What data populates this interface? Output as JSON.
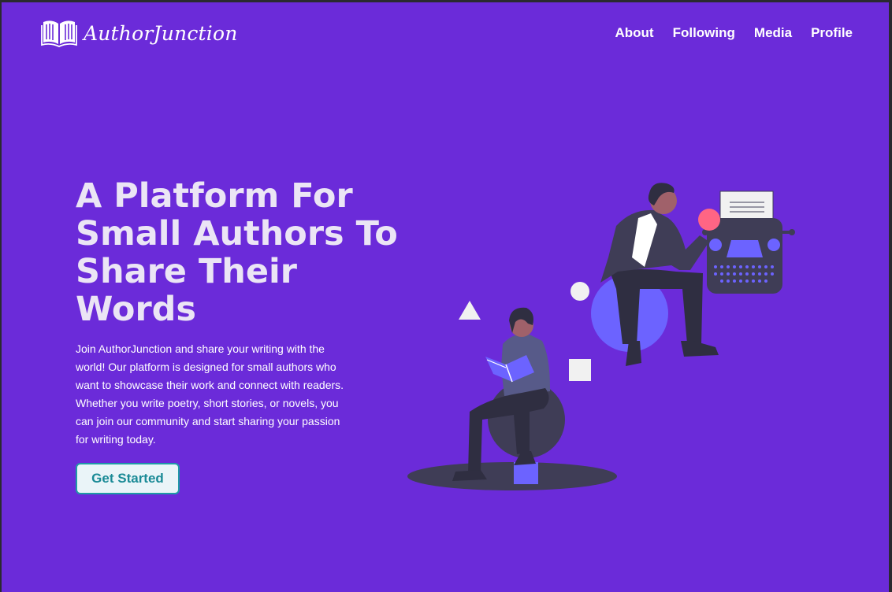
{
  "brand": {
    "name": "AuthorJunction",
    "icon": "open-book-icon"
  },
  "nav": {
    "items": [
      {
        "label": "About"
      },
      {
        "label": "Following"
      },
      {
        "label": "Media"
      },
      {
        "label": "Profile"
      }
    ]
  },
  "hero": {
    "title": "A Platform For Small Authors To Share Their Words",
    "description": "Join AuthorJunction and share your writing with the world! Our platform is designed for small authors who want to showcase their work and connect with readers. Whether you write poetry, short stories, or novels, you can join our community and start sharing your passion for writing today.",
    "cta_label": "Get Started"
  },
  "colors": {
    "background": "#6b2bd9",
    "button_bg": "#eaf4f8",
    "button_border": "#1f9aa6",
    "button_text": "#1a8a96",
    "illustration_accent": "#6c63ff",
    "illustration_dark": "#3f3d56"
  }
}
